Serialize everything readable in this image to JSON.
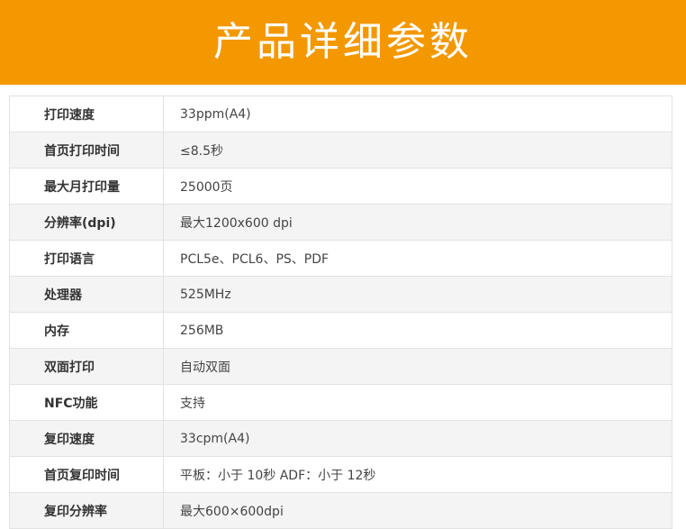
{
  "header": {
    "title": "产品详细参数"
  },
  "colors": {
    "banner": "#f39800",
    "row_alt": "#f4f4f4",
    "border": "#e2e2e2"
  },
  "specs": [
    {
      "label": "打印速度",
      "value": "33ppm(A4)"
    },
    {
      "label": "首页打印时间",
      "value": "≤8.5秒"
    },
    {
      "label": "最大月打印量",
      "value": "25000页"
    },
    {
      "label": "分辨率(dpi)",
      "value": "最大1200x600 dpi"
    },
    {
      "label": "打印语言",
      "value": "PCL5e、PCL6、PS、PDF"
    },
    {
      "label": "处理器",
      "value": "525MHz"
    },
    {
      "label": "内存",
      "value": "256MB"
    },
    {
      "label": "双面打印",
      "value": "自动双面"
    },
    {
      "label": "NFC功能",
      "value": "支持"
    },
    {
      "label": "复印速度",
      "value": "33cpm(A4)"
    },
    {
      "label": "首页复印时间",
      "value": "平板：小于 10秒 ADF：小于 12秒"
    },
    {
      "label": "复印分辨率",
      "value": "最大600×600dpi"
    }
  ]
}
